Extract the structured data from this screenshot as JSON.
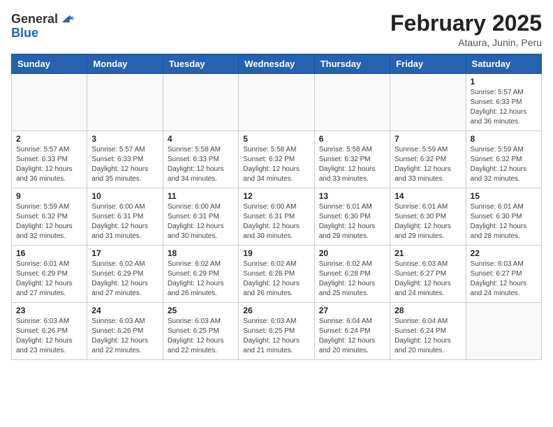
{
  "header": {
    "logo_general": "General",
    "logo_blue": "Blue",
    "month_title": "February 2025",
    "subtitle": "Ataura, Junin, Peru"
  },
  "weekdays": [
    "Sunday",
    "Monday",
    "Tuesday",
    "Wednesday",
    "Thursday",
    "Friday",
    "Saturday"
  ],
  "weeks": [
    [
      {
        "day": "",
        "info": ""
      },
      {
        "day": "",
        "info": ""
      },
      {
        "day": "",
        "info": ""
      },
      {
        "day": "",
        "info": ""
      },
      {
        "day": "",
        "info": ""
      },
      {
        "day": "",
        "info": ""
      },
      {
        "day": "1",
        "info": "Sunrise: 5:57 AM\nSunset: 6:33 PM\nDaylight: 12 hours\nand 36 minutes."
      }
    ],
    [
      {
        "day": "2",
        "info": "Sunrise: 5:57 AM\nSunset: 6:33 PM\nDaylight: 12 hours\nand 36 minutes."
      },
      {
        "day": "3",
        "info": "Sunrise: 5:57 AM\nSunset: 6:33 PM\nDaylight: 12 hours\nand 35 minutes."
      },
      {
        "day": "4",
        "info": "Sunrise: 5:58 AM\nSunset: 6:33 PM\nDaylight: 12 hours\nand 34 minutes."
      },
      {
        "day": "5",
        "info": "Sunrise: 5:58 AM\nSunset: 6:32 PM\nDaylight: 12 hours\nand 34 minutes."
      },
      {
        "day": "6",
        "info": "Sunrise: 5:58 AM\nSunset: 6:32 PM\nDaylight: 12 hours\nand 33 minutes."
      },
      {
        "day": "7",
        "info": "Sunrise: 5:59 AM\nSunset: 6:32 PM\nDaylight: 12 hours\nand 33 minutes."
      },
      {
        "day": "8",
        "info": "Sunrise: 5:59 AM\nSunset: 6:32 PM\nDaylight: 12 hours\nand 32 minutes."
      }
    ],
    [
      {
        "day": "9",
        "info": "Sunrise: 5:59 AM\nSunset: 6:32 PM\nDaylight: 12 hours\nand 32 minutes."
      },
      {
        "day": "10",
        "info": "Sunrise: 6:00 AM\nSunset: 6:31 PM\nDaylight: 12 hours\nand 31 minutes."
      },
      {
        "day": "11",
        "info": "Sunrise: 6:00 AM\nSunset: 6:31 PM\nDaylight: 12 hours\nand 30 minutes."
      },
      {
        "day": "12",
        "info": "Sunrise: 6:00 AM\nSunset: 6:31 PM\nDaylight: 12 hours\nand 30 minutes."
      },
      {
        "day": "13",
        "info": "Sunrise: 6:01 AM\nSunset: 6:30 PM\nDaylight: 12 hours\nand 29 minutes."
      },
      {
        "day": "14",
        "info": "Sunrise: 6:01 AM\nSunset: 6:30 PM\nDaylight: 12 hours\nand 29 minutes."
      },
      {
        "day": "15",
        "info": "Sunrise: 6:01 AM\nSunset: 6:30 PM\nDaylight: 12 hours\nand 28 minutes."
      }
    ],
    [
      {
        "day": "16",
        "info": "Sunrise: 6:01 AM\nSunset: 6:29 PM\nDaylight: 12 hours\nand 27 minutes."
      },
      {
        "day": "17",
        "info": "Sunrise: 6:02 AM\nSunset: 6:29 PM\nDaylight: 12 hours\nand 27 minutes."
      },
      {
        "day": "18",
        "info": "Sunrise: 6:02 AM\nSunset: 6:29 PM\nDaylight: 12 hours\nand 26 minutes."
      },
      {
        "day": "19",
        "info": "Sunrise: 6:02 AM\nSunset: 6:28 PM\nDaylight: 12 hours\nand 26 minutes."
      },
      {
        "day": "20",
        "info": "Sunrise: 6:02 AM\nSunset: 6:28 PM\nDaylight: 12 hours\nand 25 minutes."
      },
      {
        "day": "21",
        "info": "Sunrise: 6:03 AM\nSunset: 6:27 PM\nDaylight: 12 hours\nand 24 minutes."
      },
      {
        "day": "22",
        "info": "Sunrise: 6:03 AM\nSunset: 6:27 PM\nDaylight: 12 hours\nand 24 minutes."
      }
    ],
    [
      {
        "day": "23",
        "info": "Sunrise: 6:03 AM\nSunset: 6:26 PM\nDaylight: 12 hours\nand 23 minutes."
      },
      {
        "day": "24",
        "info": "Sunrise: 6:03 AM\nSunset: 6:26 PM\nDaylight: 12 hours\nand 22 minutes."
      },
      {
        "day": "25",
        "info": "Sunrise: 6:03 AM\nSunset: 6:25 PM\nDaylight: 12 hours\nand 22 minutes."
      },
      {
        "day": "26",
        "info": "Sunrise: 6:03 AM\nSunset: 6:25 PM\nDaylight: 12 hours\nand 21 minutes."
      },
      {
        "day": "27",
        "info": "Sunrise: 6:04 AM\nSunset: 6:24 PM\nDaylight: 12 hours\nand 20 minutes."
      },
      {
        "day": "28",
        "info": "Sunrise: 6:04 AM\nSunset: 6:24 PM\nDaylight: 12 hours\nand 20 minutes."
      },
      {
        "day": "",
        "info": ""
      }
    ]
  ]
}
